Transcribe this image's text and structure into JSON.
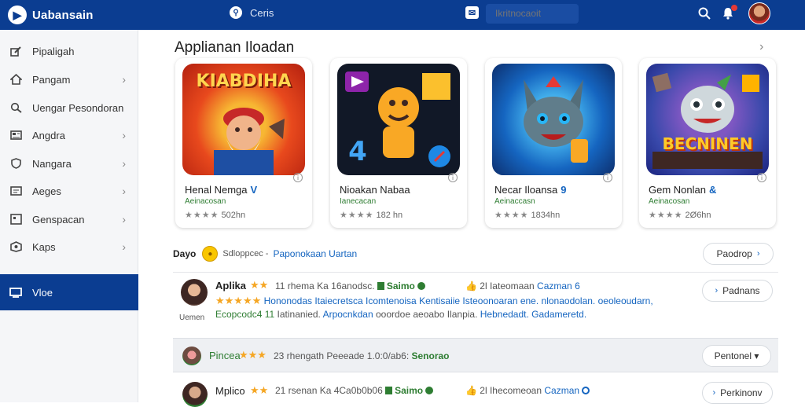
{
  "header": {
    "brand": "Uabansain",
    "search_label": "Ceris",
    "search_placeholder": "Ikritnocaoit"
  },
  "sidebar": {
    "items": [
      {
        "label": "Pipaligah",
        "icon": "edit-icon"
      },
      {
        "label": "Pangam",
        "icon": "home-icon"
      },
      {
        "label": "Uengar Pesondoran",
        "icon": "search-icon"
      },
      {
        "label": "Angdra",
        "icon": "grid-icon"
      },
      {
        "label": "Nangara",
        "icon": "shield-icon"
      },
      {
        "label": "Aeges",
        "icon": "list-icon"
      },
      {
        "label": "Genspacan",
        "icon": "message-icon"
      },
      {
        "label": "Kaps",
        "icon": "map-icon"
      }
    ],
    "active": {
      "label": "Vloe",
      "icon": "monitor-icon"
    }
  },
  "featured": {
    "title": "Applianan Iloadan",
    "apps": [
      {
        "art_text": "KIABDIHA",
        "name": "Henal Nemga",
        "ver": "V",
        "dev": "Aeinacosan",
        "meta": "502hn"
      },
      {
        "art_text": "4",
        "name": "Nioakan Nabaa",
        "ver": "",
        "dev": "Ianecacan",
        "meta": "182 hn"
      },
      {
        "art_text": "",
        "name": "Necar Iloansa",
        "ver": "9",
        "dev": "Aeinaccasn",
        "meta": "1834hn"
      },
      {
        "art_text": "BECNINEN",
        "name": "Gem Nonlan",
        "ver": "&",
        "dev": "Aeinacosan",
        "meta": "2Ø6hn"
      }
    ]
  },
  "reviews": {
    "header_title": "Dayo",
    "header_sub": "Sdloppcec -",
    "header_link": "Paponokaan Uartan",
    "header_button": "Paodrop",
    "items": [
      {
        "name": "Aplika",
        "stars": "★★",
        "line1": "11 rhema Ka 16anodsc.",
        "tag": "Saimo",
        "count": "2l Iateomaan",
        "badge": "Cazman",
        "badge_icon": "6",
        "button": "Padnans",
        "body1_stars": "★★★★★",
        "body1": "Hononodas Itaiecretsca Icomtenoisa Kentisaiie Isteoonoaran ene.",
        "body1_link": "nlonaodolan. oeoleoudarn,",
        "body2_prefix": "Ecopcodc4 11",
        "body2": "Iatinanied.",
        "body2_link": "Arpocnkdan",
        "body2_mid": "ooordoe aeoabo Ilanpia.",
        "body2_end": "Hebnedadt. Gadameretd.",
        "caption": "Uemen"
      },
      {
        "name": "Pincea",
        "stars": "★★★",
        "line1": "23 rhengath Peeeade 1.0:0/ab6:",
        "tag": "Senorao",
        "button": "Pentonel ▾"
      },
      {
        "name": "Mplico",
        "stars": "★★",
        "line1": "21 rsenan Ka 4Ca0b0b06",
        "tag": "Saimo",
        "count": "2l Ihecomeoan",
        "badge": "Cazman",
        "button": "Perkinonv"
      }
    ]
  }
}
